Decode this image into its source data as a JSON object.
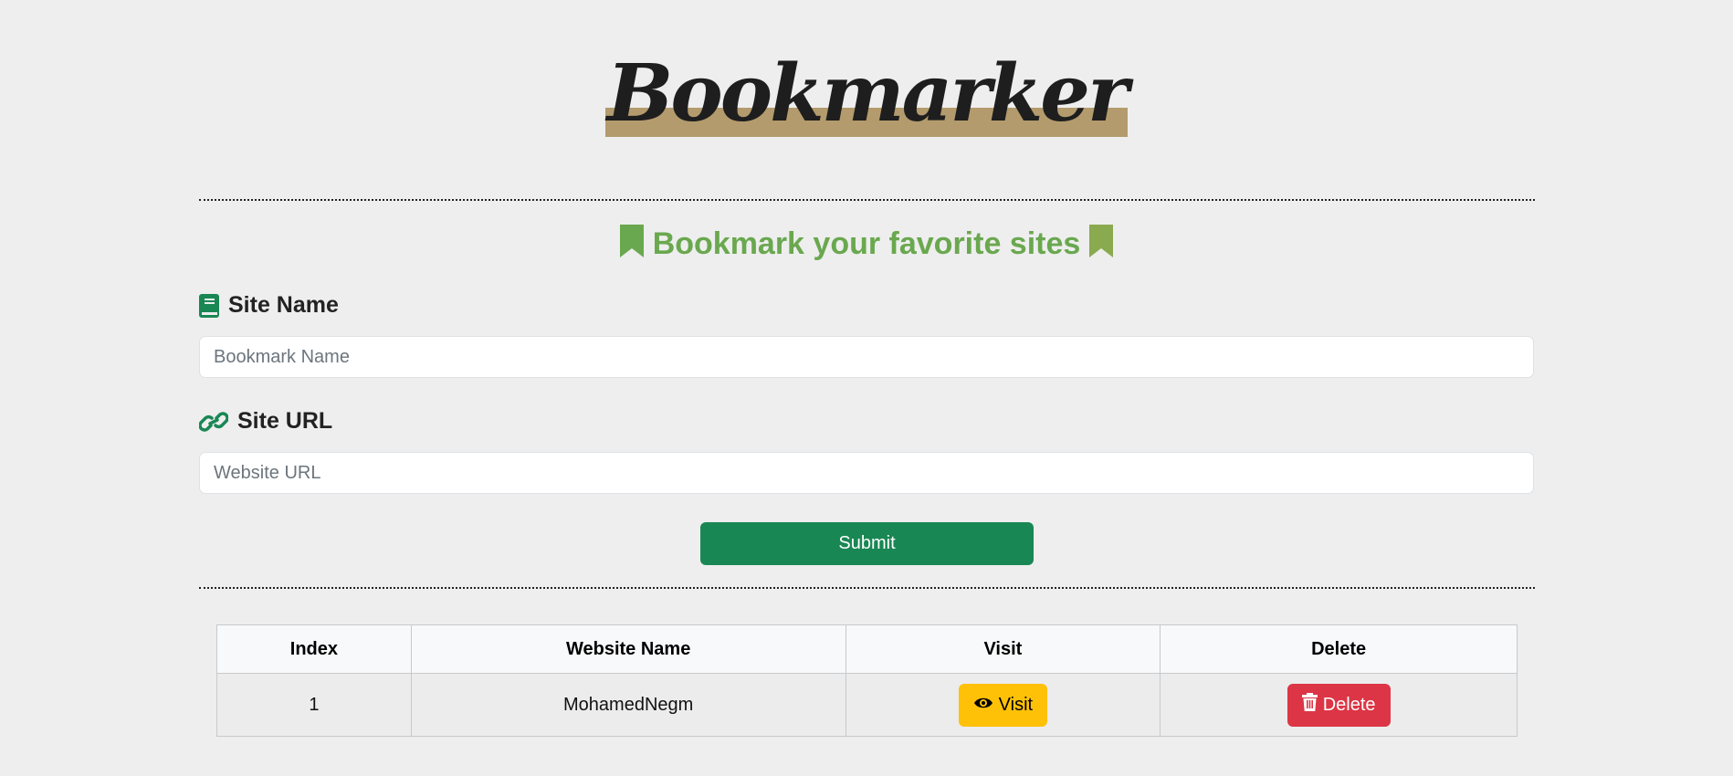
{
  "app": {
    "logo_text": "Bookmarker",
    "logo_band_color": "#b49b6d",
    "accent_color": "#6aa84f"
  },
  "form": {
    "heading": "Bookmark your favorite sites",
    "heading_icon": "bookmark-icon",
    "site_name": {
      "label": "Site Name",
      "icon": "book-icon",
      "placeholder": "Bookmark Name",
      "value": ""
    },
    "site_url": {
      "label": "Site URL",
      "icon": "link-icon",
      "placeholder": "Website URL",
      "value": ""
    },
    "submit_label": "Submit",
    "submit_color": "#198754"
  },
  "table": {
    "columns": [
      "Index",
      "Website Name",
      "Visit",
      "Delete"
    ],
    "rows": [
      {
        "index": "1",
        "name": "MohamedNegm",
        "visit_label": "Visit",
        "visit_icon": "eye-icon",
        "delete_label": "Delete",
        "delete_icon": "trash-icon"
      }
    ],
    "visit_color": "#ffc107",
    "delete_color": "#dc3545"
  }
}
